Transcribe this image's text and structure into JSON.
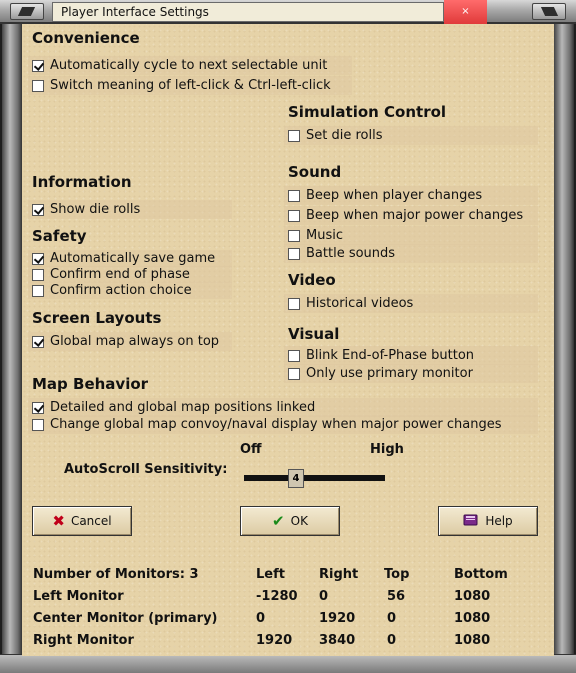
{
  "window": {
    "title": "Player Interface Settings",
    "close_glyph": "×"
  },
  "sections": {
    "convenience": {
      "title": "Convenience",
      "options": [
        {
          "label": "Automatically cycle to next selectable unit",
          "checked": true
        },
        {
          "label": "Switch meaning of left-click & Ctrl-left-click",
          "checked": false
        }
      ]
    },
    "simulation_control": {
      "title": "Simulation Control",
      "options": [
        {
          "label": "Set die rolls",
          "checked": false
        }
      ]
    },
    "information": {
      "title": "Information",
      "options": [
        {
          "label": "Show die rolls",
          "checked": true
        }
      ]
    },
    "sound": {
      "title": "Sound",
      "options": [
        {
          "label": "Beep when player changes",
          "checked": false
        },
        {
          "label": "Beep when major power changes",
          "checked": false
        },
        {
          "label": "Music",
          "checked": false
        },
        {
          "label": "Battle sounds",
          "checked": false
        }
      ]
    },
    "safety": {
      "title": "Safety",
      "options": [
        {
          "label": "Automatically save game",
          "checked": true
        },
        {
          "label": "Confirm end of phase",
          "checked": false
        },
        {
          "label": "Confirm action choice",
          "checked": false
        }
      ]
    },
    "video": {
      "title": "Video",
      "options": [
        {
          "label": "Historical videos",
          "checked": false
        }
      ]
    },
    "screen_layouts": {
      "title": "Screen Layouts",
      "options": [
        {
          "label": "Global map always on top",
          "checked": true
        }
      ]
    },
    "visual": {
      "title": "Visual",
      "options": [
        {
          "label": "Blink End-of-Phase button",
          "checked": false
        },
        {
          "label": "Only use primary monitor",
          "checked": false
        }
      ]
    },
    "map_behavior": {
      "title": "Map Behavior",
      "options": [
        {
          "label": "Detailed and global map positions linked",
          "checked": true
        },
        {
          "label": "Change global map convoy/naval display when major power changes",
          "checked": false
        }
      ]
    }
  },
  "autoscroll": {
    "label": "AutoScroll Sensitivity:",
    "min_label": "Off",
    "max_label": "High",
    "value": "4"
  },
  "buttons": {
    "cancel": {
      "label": "Cancel",
      "icon": "x-icon"
    },
    "ok": {
      "label": "OK",
      "icon": "check-icon"
    },
    "help": {
      "label": "Help",
      "icon": "book-icon"
    }
  },
  "monitors": {
    "count_label": "Number of Monitors: 3",
    "headers": [
      "Left",
      "Right",
      "Top",
      "Bottom"
    ],
    "rows": [
      {
        "name": "Left Monitor",
        "values": [
          "-1280",
          "0",
          "56",
          "1080"
        ]
      },
      {
        "name": "Center Monitor (primary)",
        "values": [
          "0",
          "1920",
          "0",
          "1080"
        ]
      },
      {
        "name": "Right Monitor",
        "values": [
          "1920",
          "3840",
          "0",
          "1080"
        ]
      }
    ]
  },
  "colors": {
    "panel_bg": "#e6d3a8",
    "close_button": "#e03a3a",
    "cancel_icon": "#c0001a",
    "ok_icon": "#1a8a1a",
    "help_icon": "#7a2a8a"
  }
}
